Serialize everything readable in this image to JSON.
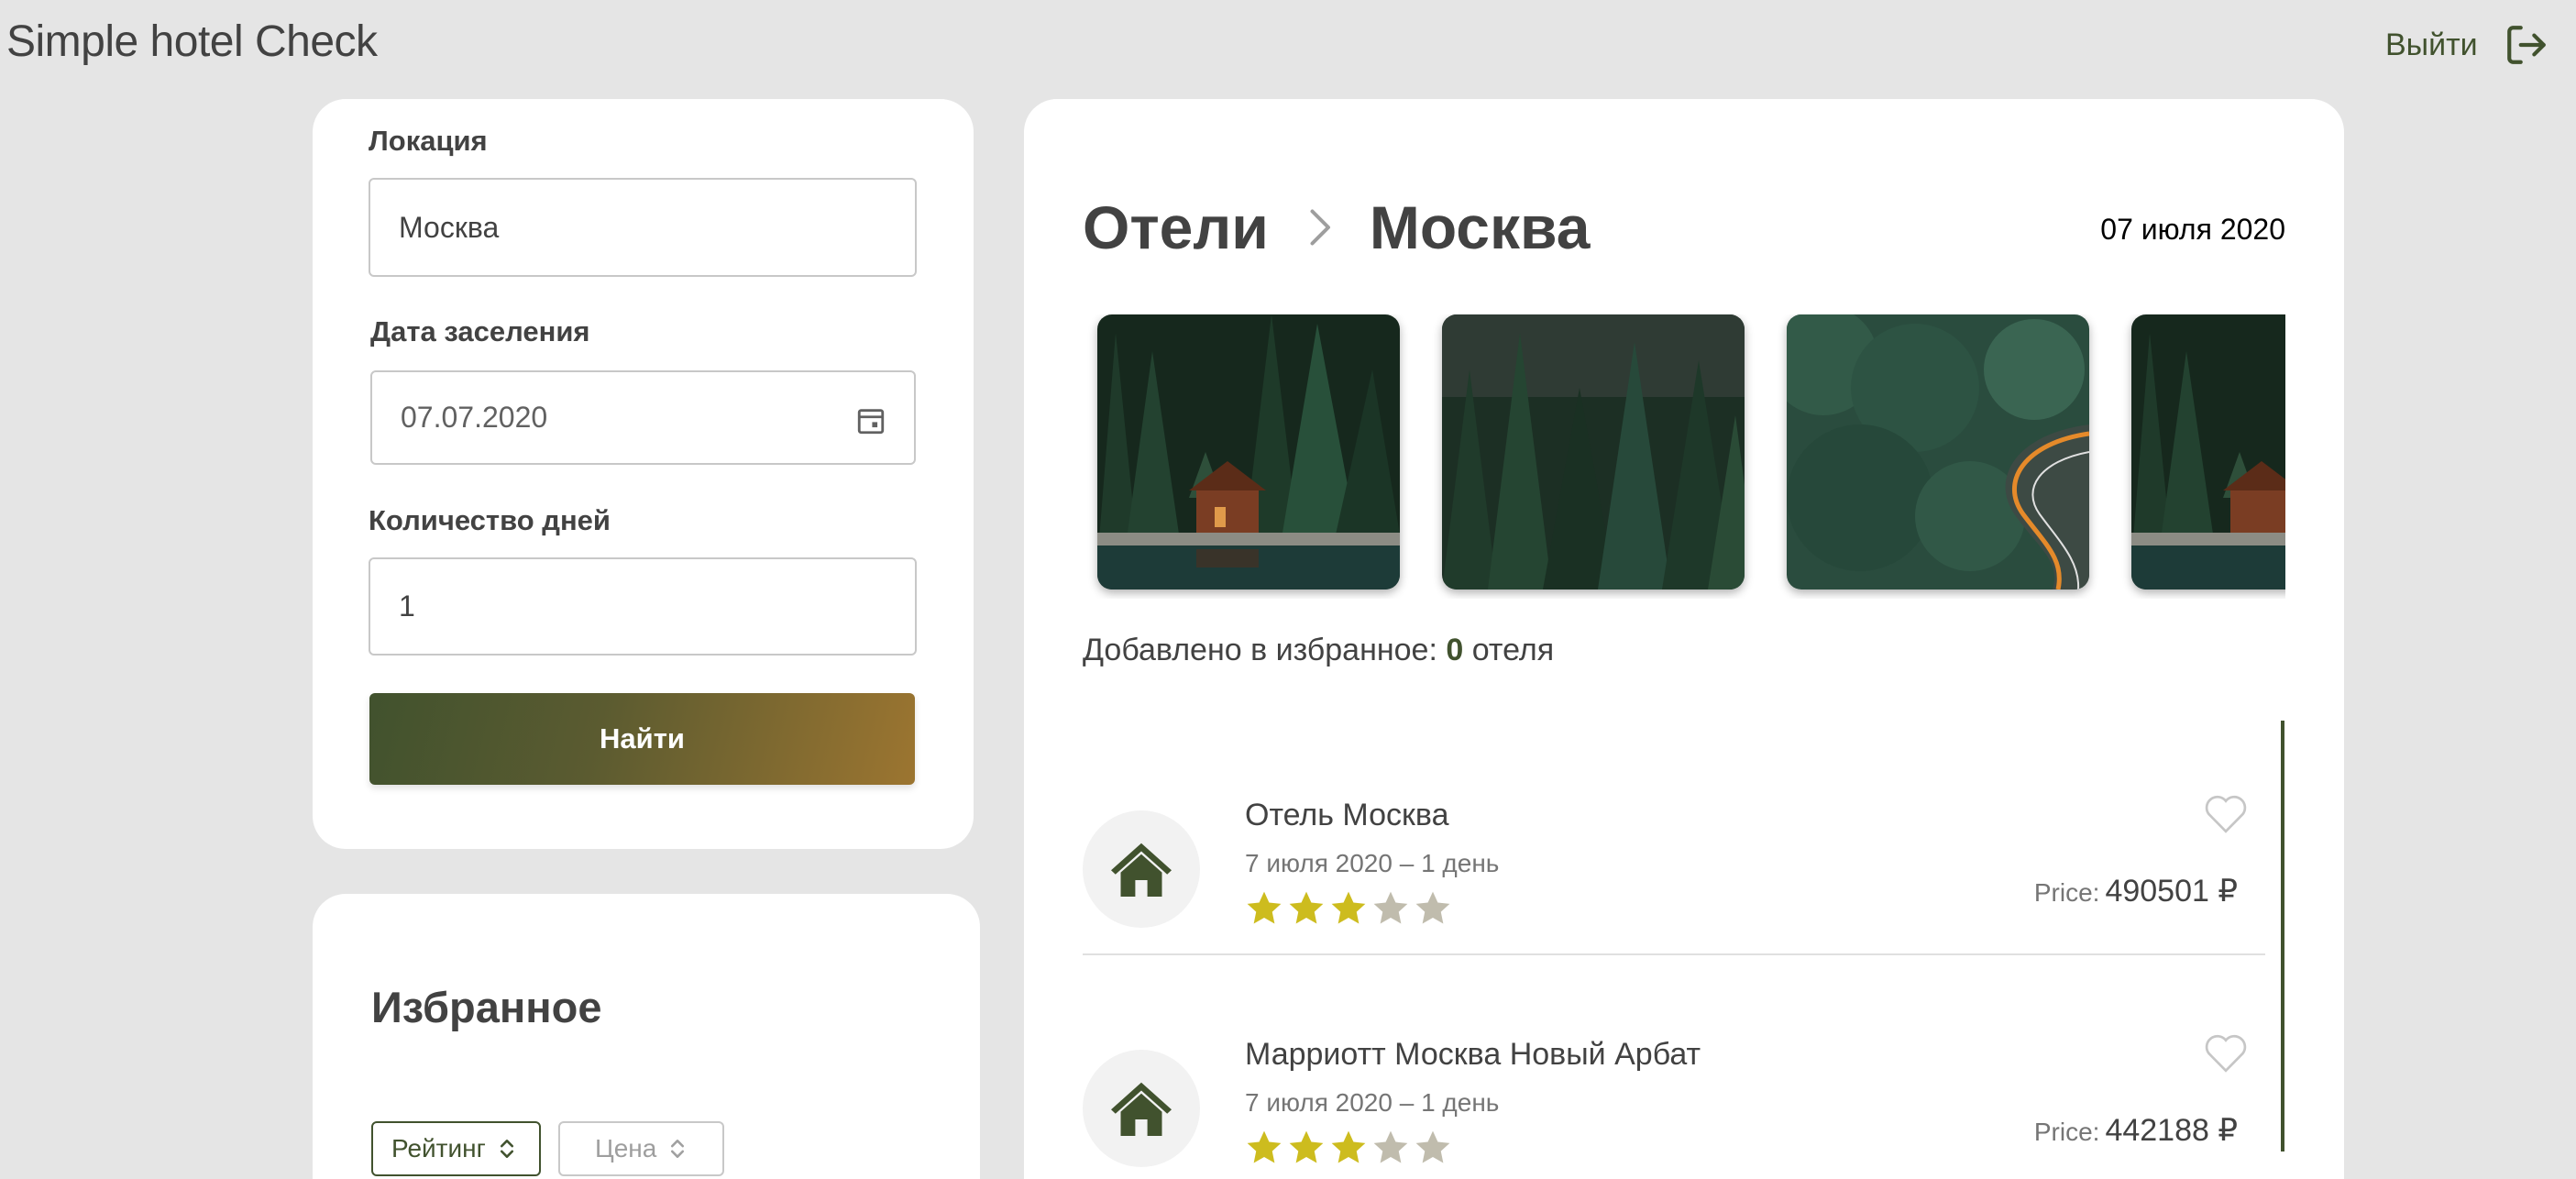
{
  "app": {
    "title": "Simple hotel Check"
  },
  "header": {
    "logout_label": "Выйти"
  },
  "filters": {
    "location_label": "Локация",
    "location_value": "Москва",
    "checkin_label": "Дата заселения",
    "checkin_value": "07.07.2020",
    "days_label": "Количество дней",
    "days_value": "1",
    "search_button": "Найти"
  },
  "favorites": {
    "title": "Избранное",
    "sort_rating": "Рейтинг",
    "sort_price": "Цена"
  },
  "main": {
    "crumb_root": "Отели",
    "crumb_city": "Москва",
    "date": "07 июля 2020",
    "fav_prefix": "Добавлено в избранное:",
    "fav_count": "0",
    "fav_suffix": "отеля",
    "photos": [
      {
        "icon": "forest-cabin-photo"
      },
      {
        "icon": "dark-forest-photo"
      },
      {
        "icon": "forest-road-photo"
      },
      {
        "icon": "forest-cabin-photo"
      }
    ],
    "price_label": "Price:",
    "hotels": [
      {
        "name": "Отель Москва",
        "date": "7 июля 2020 – 1 день",
        "stars": 3,
        "price": "490501 ₽"
      },
      {
        "name": "Марриотт Москва Новый Арбат",
        "date": "7 июля 2020 – 1 день",
        "stars": 3,
        "price": "442188 ₽"
      }
    ]
  },
  "colors": {
    "accent": "#41522e",
    "button_gradient_end": "#9c7530",
    "star_active": "#cdbc1e",
    "star_inactive": "#c0bcad",
    "background": "#e5e5e5"
  }
}
